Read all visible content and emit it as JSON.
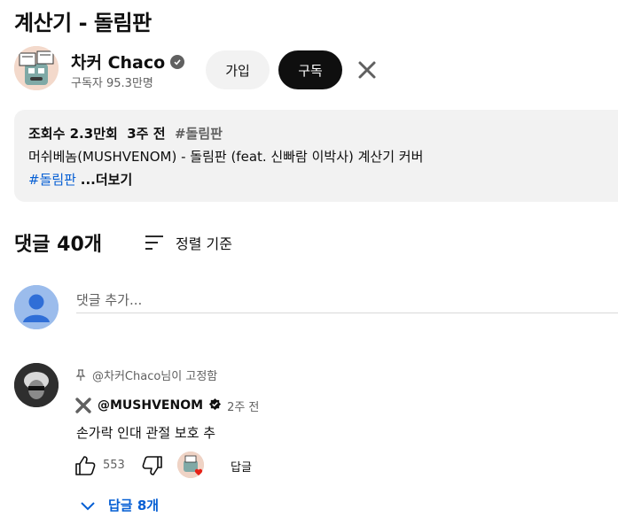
{
  "video": {
    "title": "계산기 - 돌림판"
  },
  "channel": {
    "name": "차커 Chaco",
    "subscribers": "구독자 95.3만명",
    "join_label": "가입",
    "subscribe_label": "구독"
  },
  "description": {
    "views": "조회수 2.3만회",
    "age": "3주 전",
    "hashtag": "#돌림판",
    "text": "머쉬베놈(MUSHVENOM) - 돌림판 (feat. 신빠람 이박사) 계산기 커버",
    "link_tag": "#돌림판",
    "more": "...더보기"
  },
  "comments": {
    "count_label": "댓글 40개",
    "sort_label": "정렬 기준",
    "add_placeholder": "댓글 추가...",
    "items": [
      {
        "pinned_label": "@차커Chaco님이 고정함",
        "author": "@MUSHVENOM",
        "time": "2주 전",
        "text": "손가락 인대 관절 보호 추",
        "likes": "553",
        "reply_label": "답글",
        "replies_label": "답글 8개"
      }
    ]
  },
  "icons": {
    "verified": "verified-check-icon",
    "close": "close-x-icon",
    "sort": "sort-lines-icon",
    "pin": "pin-icon",
    "like": "thumbs-up-icon",
    "dislike": "thumbs-down-icon",
    "expand": "chevron-down-icon"
  },
  "colors": {
    "link": "#065fd4",
    "subscribe_bg": "#0f0f0f",
    "chip_bg": "#f2f2f2",
    "muted": "#606060"
  }
}
